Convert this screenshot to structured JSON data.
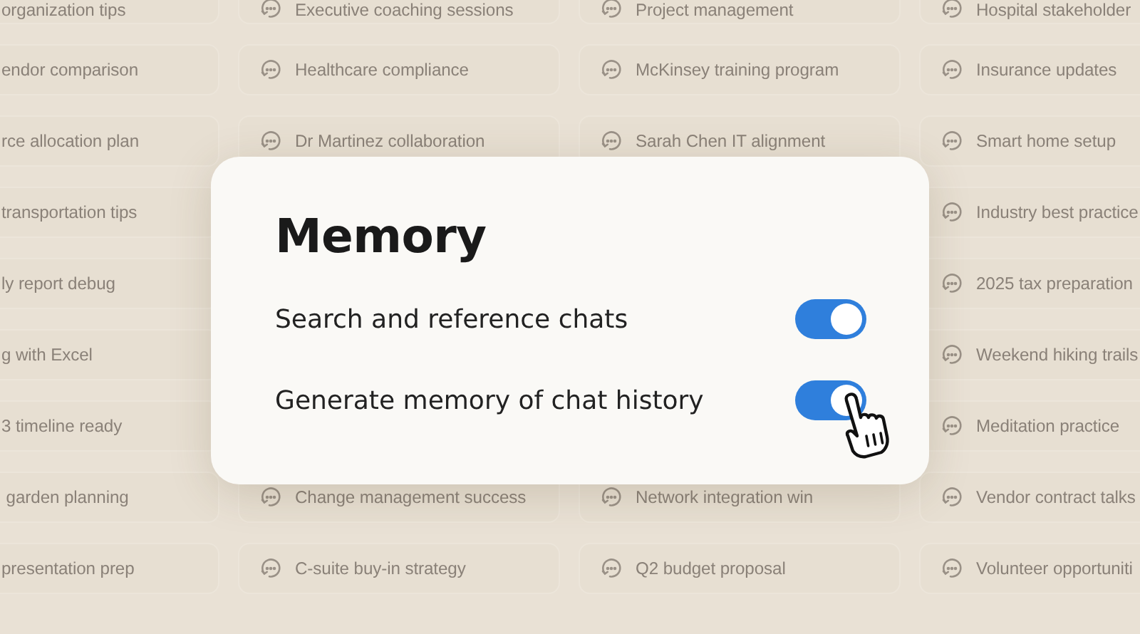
{
  "chat_columns": [
    {
      "above": [
        {
          "title": "organization tips"
        },
        {
          "title": "endor comparison"
        },
        {
          "title": "rce allocation plan"
        },
        {
          "title": "transportation tips"
        },
        {
          "title": "ly report debug"
        },
        {
          "title": "g with Excel"
        },
        {
          "title": "3 timeline ready"
        },
        {
          "title": " garden planning"
        },
        {
          "title": "presentation prep"
        }
      ]
    },
    {
      "above": [
        {
          "title": "Executive coaching sessions"
        },
        {
          "title": "Healthcare compliance"
        },
        {
          "title": "Dr Martinez collaboration"
        }
      ],
      "below": [
        {
          "title": "Change management success"
        },
        {
          "title": "C-suite buy-in strategy"
        }
      ]
    },
    {
      "above": [
        {
          "title": "Project management"
        },
        {
          "title": "McKinsey training program"
        },
        {
          "title": "Sarah Chen IT alignment"
        }
      ],
      "below": [
        {
          "title": "Network integration win"
        },
        {
          "title": "Q2 budget proposal"
        }
      ]
    },
    {
      "above": [
        {
          "title": "Hospital stakeholder"
        },
        {
          "title": "Insurance updates"
        },
        {
          "title": "Smart home setup"
        },
        {
          "title": "Industry best practice"
        },
        {
          "title": "2025 tax preparation"
        },
        {
          "title": "Weekend hiking trails"
        },
        {
          "title": "Meditation practice"
        },
        {
          "title": "Vendor contract talks"
        },
        {
          "title": "Volunteer opportuniti"
        }
      ]
    }
  ],
  "dialog": {
    "title": "Memory",
    "settings": [
      {
        "label": "Search and reference chats",
        "on": true
      },
      {
        "label": "Generate memory of chat history",
        "on": true
      }
    ]
  }
}
